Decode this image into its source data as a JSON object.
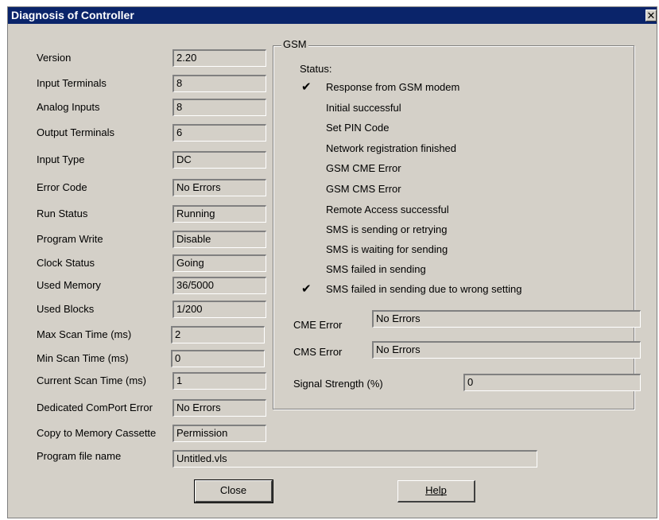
{
  "window": {
    "title": "Diagnosis of Controller",
    "close_glyph": "✕"
  },
  "left_fields": [
    {
      "label": "Version",
      "value": "2.20"
    },
    {
      "label": "Input Terminals",
      "value": "8"
    },
    {
      "label": "Analog Inputs",
      "value": "8"
    },
    {
      "label": "Output Terminals",
      "value": "6"
    },
    {
      "label": "Input Type",
      "value": "DC"
    },
    {
      "label": "Error Code",
      "value": "No Errors"
    },
    {
      "label": "Run Status",
      "value": "Running"
    },
    {
      "label": "Program Write",
      "value": "Disable"
    },
    {
      "label": "Clock Status",
      "value": "Going"
    },
    {
      "label": "Used Memory",
      "value": "36/5000"
    },
    {
      "label": "Used Blocks",
      "value": "1/200"
    },
    {
      "label": "Max Scan Time (ms)",
      "value": "2"
    },
    {
      "label": "Min Scan Time (ms)",
      "value": "0"
    },
    {
      "label": "Current Scan Time (ms)",
      "value": "1"
    },
    {
      "label": "Dedicated ComPort Error",
      "value": "No Errors"
    },
    {
      "label": "Copy to Memory Cassette",
      "value": "Permission"
    }
  ],
  "program_file": {
    "label": "Program file name",
    "value": "Untitled.vls"
  },
  "gsm": {
    "title": "GSM",
    "status_label": "Status:",
    "items": [
      {
        "label": "Response from GSM modem",
        "checked": true
      },
      {
        "label": "Initial successful",
        "checked": false
      },
      {
        "label": "Set PIN Code",
        "checked": false
      },
      {
        "label": "Network registration finished",
        "checked": false
      },
      {
        "label": "GSM CME Error",
        "checked": false
      },
      {
        "label": "GSM CMS Error",
        "checked": false
      },
      {
        "label": "Remote Access successful",
        "checked": false
      },
      {
        "label": "SMS is sending or retrying",
        "checked": false
      },
      {
        "label": "SMS is waiting for sending",
        "checked": false
      },
      {
        "label": "SMS failed in sending",
        "checked": false
      },
      {
        "label": "SMS failed in sending due to wrong setting",
        "checked": true
      }
    ],
    "check_glyph": "✔",
    "cme_error": {
      "label": "CME Error",
      "value": "No Errors"
    },
    "cms_error": {
      "label": "CMS Error",
      "value": "No Errors"
    },
    "signal": {
      "label": "Signal Strength (%)",
      "value": "0"
    }
  },
  "buttons": {
    "close": "Close",
    "help": "Help"
  }
}
